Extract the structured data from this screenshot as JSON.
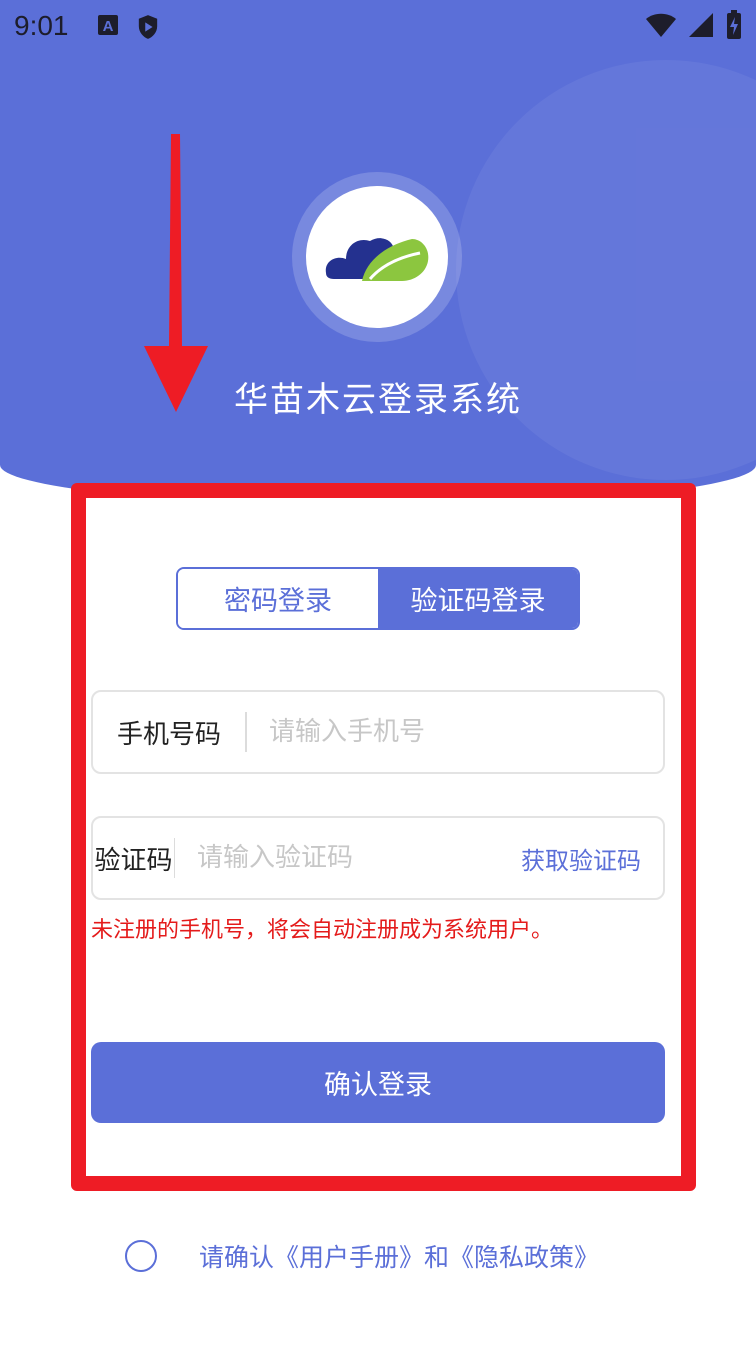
{
  "status_bar": {
    "time": "9:01",
    "left_icons": [
      "font-a-icon",
      "shield-play-icon"
    ],
    "right_icons": [
      "wifi-icon",
      "cellular-signal-icon",
      "battery-charging-icon"
    ]
  },
  "header": {
    "app_title": "华苗木云登录系统",
    "logo_colors": {
      "navy": "#24318f",
      "green": "#8cc63f"
    }
  },
  "tabs": [
    {
      "label": "密码登录",
      "active": false
    },
    {
      "label": "验证码登录",
      "active": true
    }
  ],
  "form": {
    "phone": {
      "label": "手机号码",
      "placeholder": "请输入手机号",
      "value": ""
    },
    "code": {
      "label": "验证码",
      "placeholder": "请输入验证码",
      "value": "",
      "action": "获取验证码"
    },
    "notice": "未注册的手机号，将会自动注册成为系统用户。",
    "submit_label": "确认登录"
  },
  "agreement": {
    "text": "请确认《用户手册》和《隐私政策》",
    "checked": false
  },
  "colors": {
    "primary": "#5b6fd8",
    "highlight": "#ee1c25",
    "notice": "#e41b1b"
  }
}
